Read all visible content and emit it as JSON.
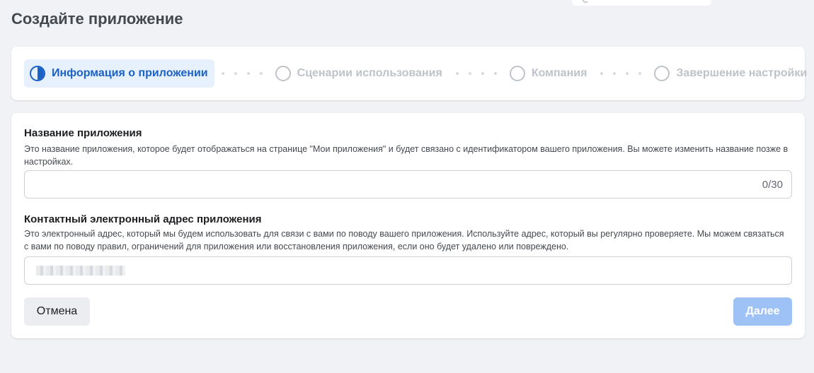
{
  "page": {
    "title": "Создайте приложение"
  },
  "steps": [
    {
      "label": "Информация о приложении",
      "state": "active"
    },
    {
      "label": "Сценарии использования",
      "state": "pending"
    },
    {
      "label": "Компания",
      "state": "pending"
    },
    {
      "label": "Завершение настройки",
      "state": "pending"
    }
  ],
  "form": {
    "app_name": {
      "label": "Название приложения",
      "description": "Это название приложения, которое будет отображаться на странице \"Мои приложения\" и будет связано с идентификатором вашего приложения. Вы можете изменить название позже в настройках.",
      "value": "",
      "counter": "0/30"
    },
    "contact_email": {
      "label": "Контактный электронный адрес приложения",
      "description": "Это электронный адрес, который мы будем использовать для связи с вами по поводу вашего приложения. Используйте адрес, который вы регулярно проверяете. Мы можем связаться с вами по поводу правил, ограничений для приложения или восстановления приложения, если оно будет удалено или повреждено."
    },
    "buttons": {
      "cancel": "Отмена",
      "next": "Далее"
    }
  },
  "colors": {
    "accent": "#1b62c6",
    "active_step_bg": "#e7f0fd",
    "inactive_step": "#bec3c9",
    "next_button_disabled": "#9ec2f5",
    "page_bg": "#f0f2f5"
  }
}
